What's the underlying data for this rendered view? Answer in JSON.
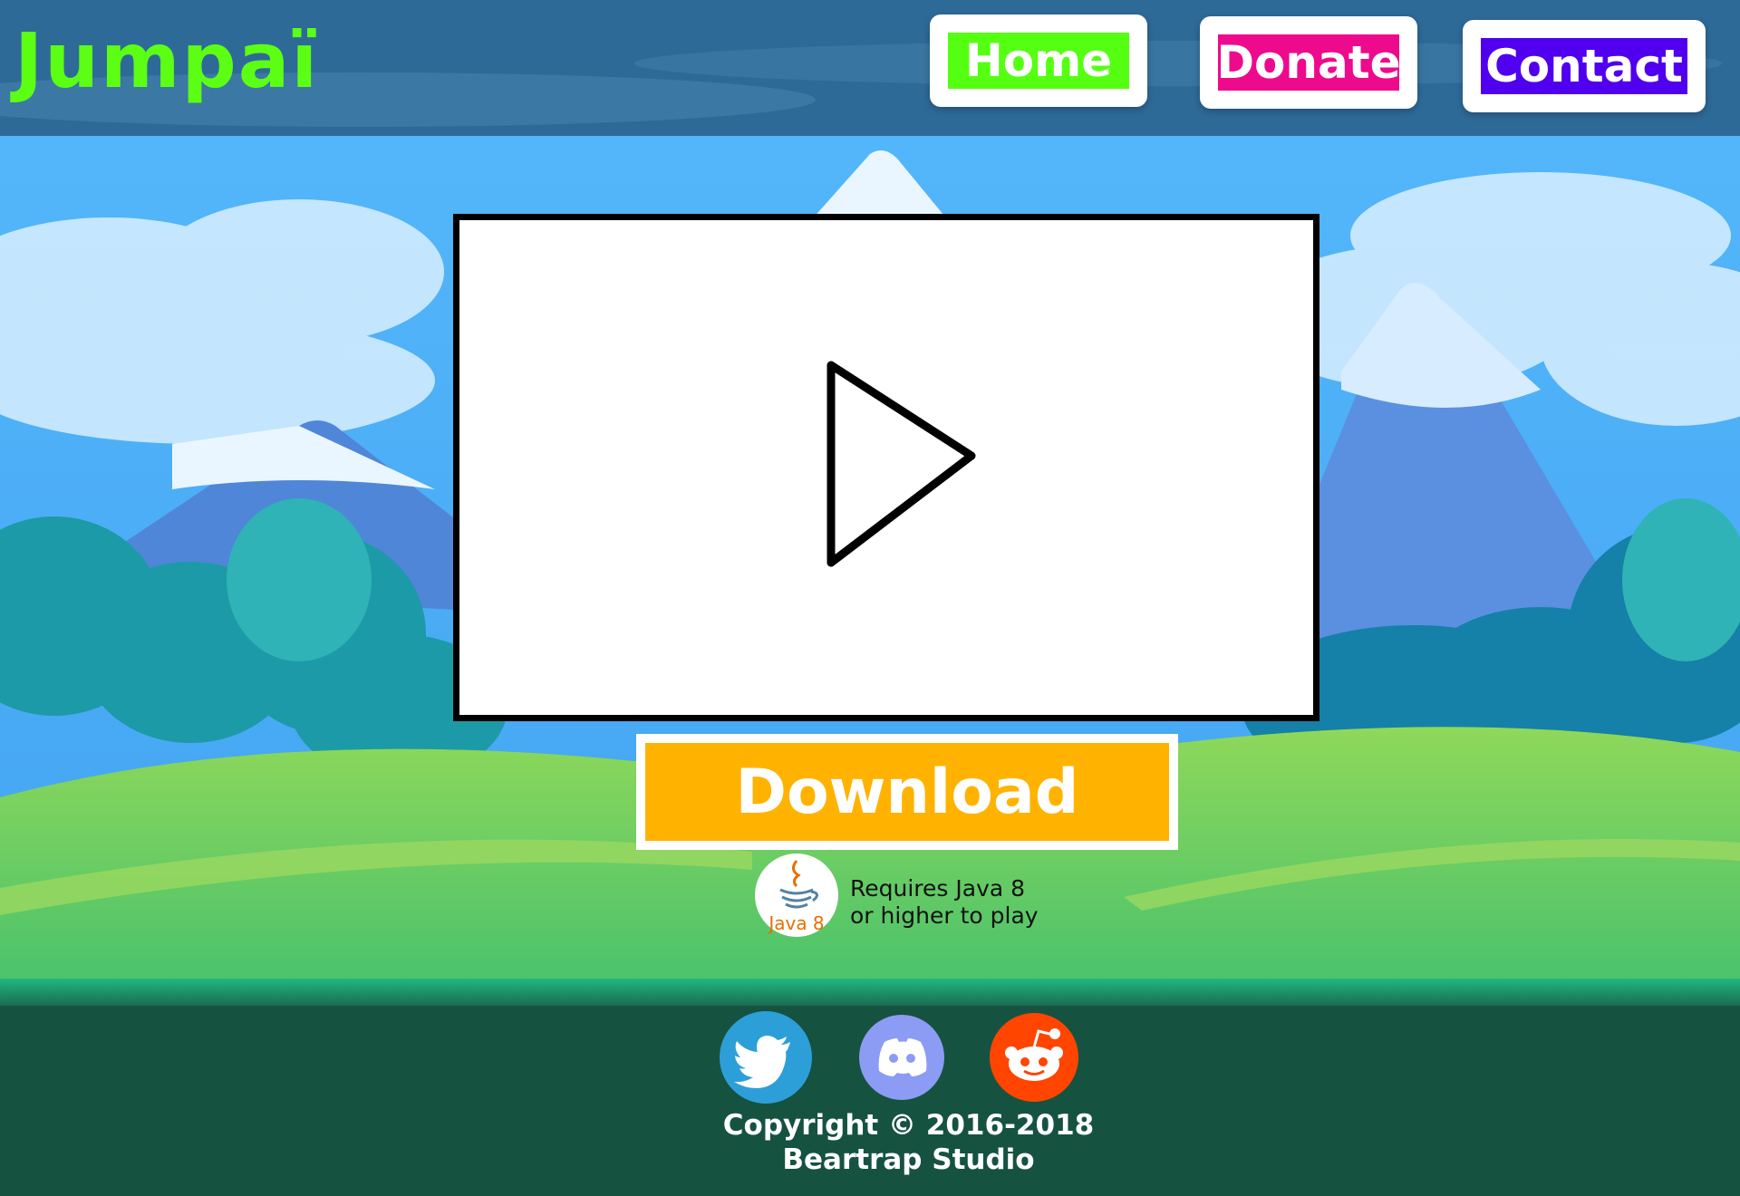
{
  "header": {
    "brand": "Jumpaï",
    "nav": [
      {
        "label": "Home",
        "color": "#55ff11"
      },
      {
        "label": "Donate",
        "color": "#ee0a8c"
      },
      {
        "label": "Contact",
        "color": "#5000ee"
      }
    ]
  },
  "main": {
    "video_icon": "play-icon",
    "download_label": "Download",
    "download_color": "#ffb300",
    "java_badge": "Java 8",
    "java_note_line1": "Requires Java 8",
    "java_note_line2": "or higher to play"
  },
  "footer": {
    "social": [
      {
        "icon": "twitter-icon",
        "color": "#2d9fd8"
      },
      {
        "icon": "discord-icon",
        "color": "#8c9cf4"
      },
      {
        "icon": "reddit-icon",
        "color": "#ff4500"
      }
    ],
    "copyright": "Copyright © 2016-2018",
    "studio": "Beartrap Studio"
  },
  "colors": {
    "header_bg": "#2e6a98",
    "sky": "#4fb2f5",
    "grass": "#6fd15a",
    "footer_bg": "#165240"
  }
}
